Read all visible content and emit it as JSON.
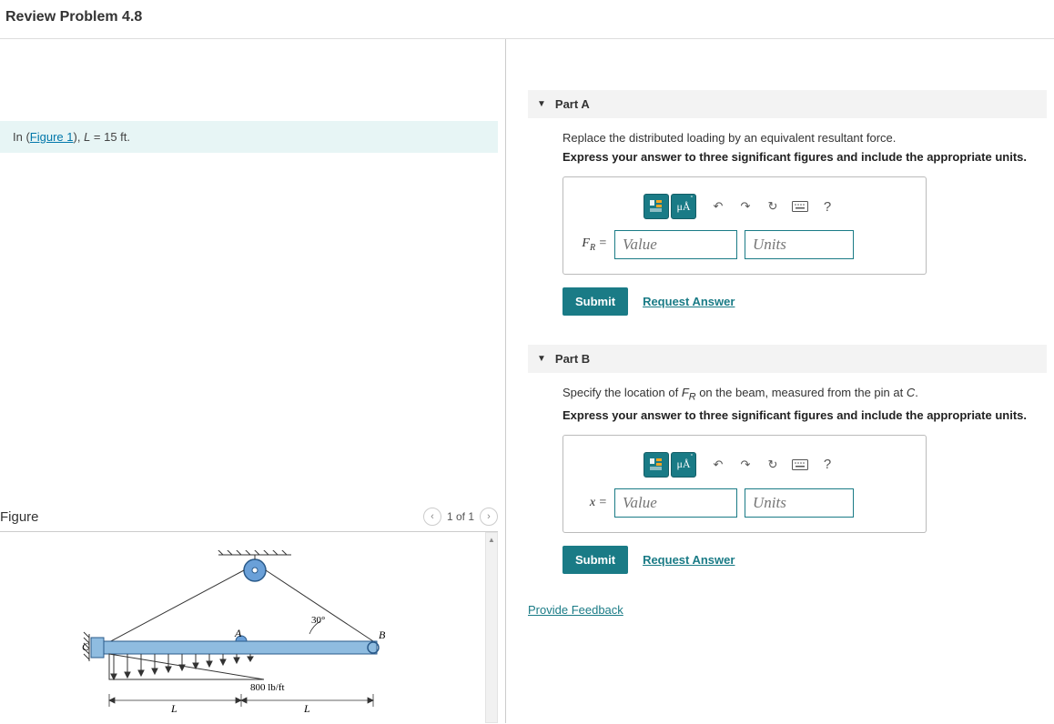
{
  "page_title": "Review Problem 4.8",
  "given": {
    "prefix": "In (",
    "link": "Figure 1",
    "suffix_html": "), <i>L</i> = 15 ft."
  },
  "figure": {
    "title": "Figure",
    "pager": "1 of 1",
    "angle": "30°",
    "labelA": "A",
    "labelB": "B",
    "labelC": "C",
    "load": "800 lb/ft",
    "dimL1": "L",
    "dimL2": "L"
  },
  "parts": [
    {
      "name": "Part A",
      "prompt": "Replace the distributed loading by an equivalent resultant force.",
      "instruction": "Express your answer to three significant figures and include the appropriate units.",
      "variable_html": "<i>F<sub>R</sub></i> =",
      "value_placeholder": "Value",
      "units_placeholder": "Units",
      "submit": "Submit",
      "request": "Request Answer"
    },
    {
      "name": "Part B",
      "prompt_html": "Specify the location of <i>F<sub>R</sub></i> on the beam, measured from the pin at <i>C</i>.",
      "instruction": "Express your answer to three significant figures and include the appropriate units.",
      "variable_html": "<i>x</i> =",
      "value_placeholder": "Value",
      "units_placeholder": "Units",
      "submit": "Submit",
      "request": "Request Answer"
    }
  ],
  "feedback": "Provide Feedback",
  "toolbar": {
    "units_label": "μÅ",
    "help": "?"
  }
}
